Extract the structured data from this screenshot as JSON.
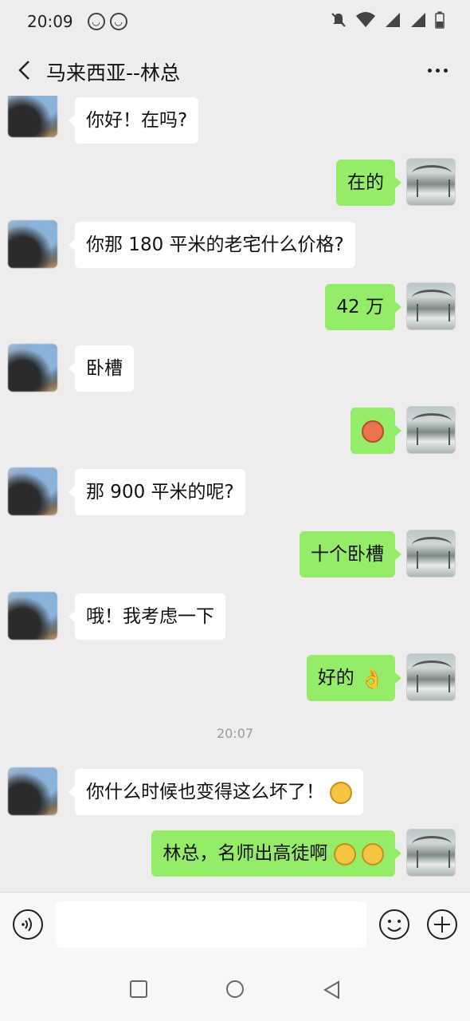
{
  "status_bar": {
    "time": "20:09"
  },
  "header": {
    "title": "马来西亚--林总"
  },
  "messages": [
    {
      "side": "left",
      "text": "你好！在吗?"
    },
    {
      "side": "right",
      "text": "在的"
    },
    {
      "side": "left",
      "text": "你那 180 平米的老宅什么价格?"
    },
    {
      "side": "right",
      "text": "42 万"
    },
    {
      "side": "left",
      "text": "卧槽"
    },
    {
      "side": "right",
      "text": "",
      "emoji": "flushed-face-emoji"
    },
    {
      "side": "left",
      "text": "那 900 平米的呢?"
    },
    {
      "side": "right",
      "text": "十个卧槽"
    },
    {
      "side": "left",
      "text": "哦！我考虑一下"
    },
    {
      "side": "right",
      "text": "好的",
      "emoji": "ok-hand-emoji"
    },
    {
      "side": "left",
      "text": "你什么时候也变得这么坏了！",
      "emoji": "grinning-face-emoji"
    },
    {
      "side": "right",
      "text": "林总，名师出高徒啊",
      "emoji": "grinning-face-emoji x2"
    }
  ],
  "timestamp": "20:07",
  "input": {
    "value": "",
    "placeholder": ""
  },
  "icons": {
    "back": "chevron-left-icon",
    "more": "more-dots-icon",
    "voice": "voice-icon",
    "emoji": "emoji-icon",
    "plus": "plus-icon"
  },
  "colors": {
    "sent_bubble": "#95ec69",
    "received_bubble": "#ffffff",
    "background": "#ededed"
  }
}
